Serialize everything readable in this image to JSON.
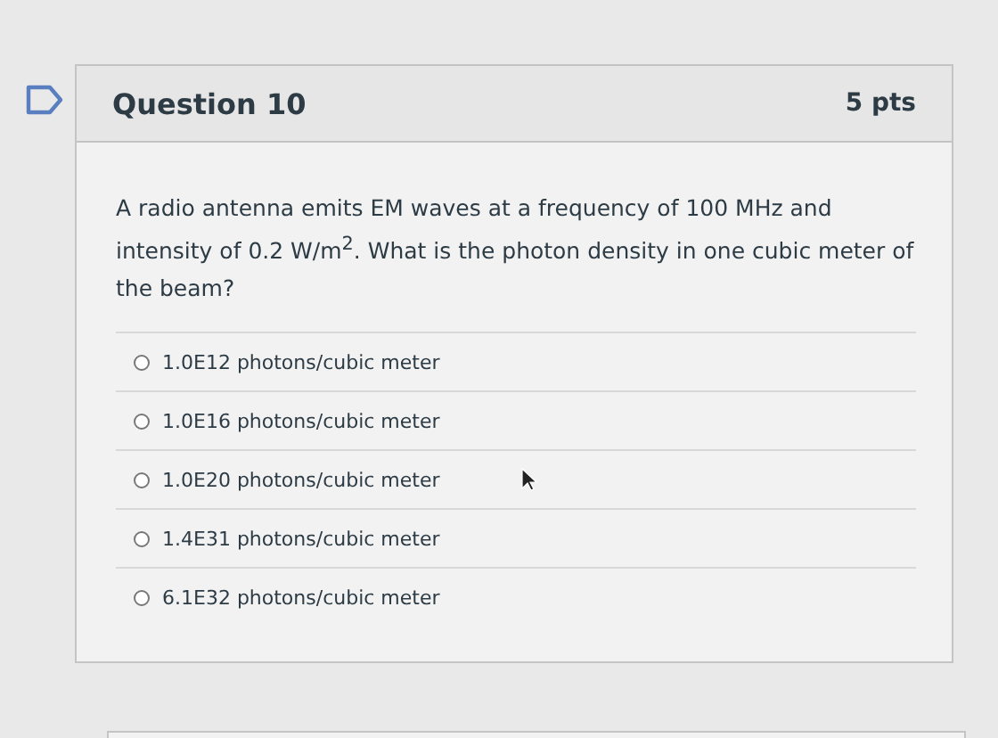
{
  "question": {
    "title": "Question 10",
    "points": "5 pts",
    "text": "A radio antenna emits EM waves at a frequency of 100 MHz and intensity of 0.2 W/m$^{2}$. What is the photon density in one cubic meter of the beam?",
    "answers": [
      {
        "label": "1.0E12 photons/cubic meter",
        "selected": false
      },
      {
        "label": "1.0E16 photons/cubic meter",
        "selected": false
      },
      {
        "label": "1.0E20 photons/cubic meter",
        "selected": false
      },
      {
        "label": "1.4E31 photons/cubic meter",
        "selected": false
      },
      {
        "label": "6.1E32 photons/cubic meter",
        "selected": false
      }
    ]
  }
}
